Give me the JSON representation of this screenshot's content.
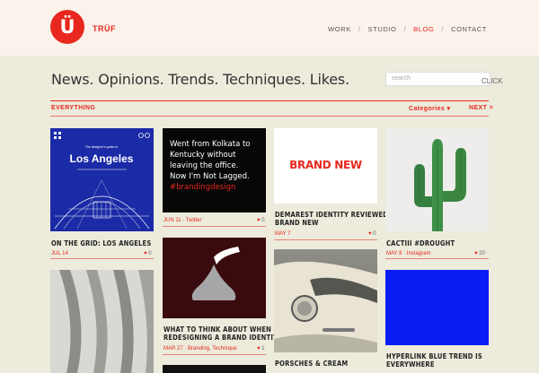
{
  "header": {
    "logo": "Ü",
    "brand": "TRÜF",
    "nav": [
      "WORK",
      "STUDIO",
      "BLOG",
      "CONTACT"
    ]
  },
  "tagline": "News. Opinions. Trends. Techniques. Likes.",
  "search": {
    "placeholder": "search",
    "button": "CLICK"
  },
  "filters": {
    "everything": "EVERYTHING",
    "categories": "Categories ▾",
    "next": "NEXT >"
  },
  "cards": {
    "la": {
      "thumb_top": "The designer's guide to",
      "thumb_title": "Los Angeles",
      "title": "ON THE GRID: LOS ANGELES",
      "meta": "JUL 14",
      "likes": "0"
    },
    "kolkata": {
      "thumb_text": [
        "Went from Kolkata to",
        "Kentucky without",
        "leaving the office.",
        "Now I'm Not Lagged."
      ],
      "thumb_tag": "#brandingdesign",
      "meta": "JUN 11 · Twitter",
      "likes": "0"
    },
    "brandnew": {
      "thumb_text": "BRAND NEW",
      "title": [
        "DEMAREST IDENTITY REVIEWED ON",
        "BRAND NEW"
      ],
      "meta": "MAY 7",
      "likes": "0"
    },
    "cactii": {
      "title": "CACTIII #DROUGHT",
      "meta": "MAY 8 · Instagram",
      "likes": "20"
    },
    "kisses": {
      "title": [
        "WHAT TO THINK ABOUT WHEN",
        "REDESIGNING A BRAND IDENTITY"
      ],
      "meta": "MAR 27 · Branding, Technique",
      "likes": "1"
    },
    "porsche": {
      "title": "PORSCHES & CREAM"
    },
    "blue": {
      "title": [
        "HYPERLINK BLUE TREND IS",
        "EVERYWHERE"
      ]
    }
  },
  "colors": {
    "accent": "#e8281e",
    "la_blue": "#1b2aa6",
    "hyperlink_blue": "#0a1df5",
    "maroon": "#3a0b0e"
  }
}
